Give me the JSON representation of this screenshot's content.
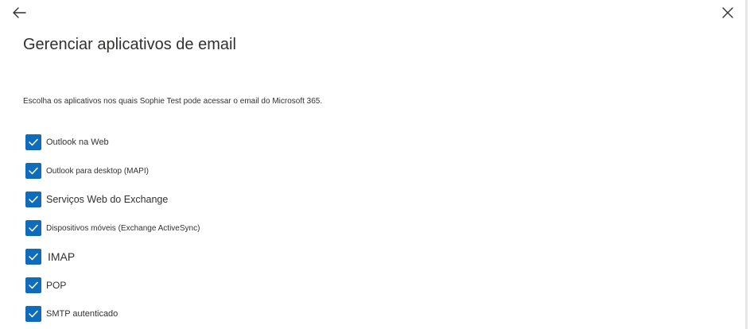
{
  "header": {
    "back_icon": "arrow-left-icon",
    "close_icon": "close-icon",
    "title": "Gerenciar aplicativos de email"
  },
  "description": "Escolha os aplicativos nos quais Sophie Test pode acessar o email do Microsoft 365.",
  "colors": {
    "checkbox_fill": "#0f6cbd",
    "text": "#323130"
  },
  "apps": [
    {
      "label": "Outlook na Web",
      "checked": true
    },
    {
      "label": "Outlook para desktop (MAPI)",
      "checked": true
    },
    {
      "label": "Serviços Web do Exchange",
      "checked": true
    },
    {
      "label": "Dispositivos móveis (Exchange ActiveSync)",
      "checked": true
    },
    {
      "label": "IMAP",
      "checked": true
    },
    {
      "label": "POP",
      "checked": true
    },
    {
      "label": "SMTP autenticado",
      "checked": true
    }
  ]
}
